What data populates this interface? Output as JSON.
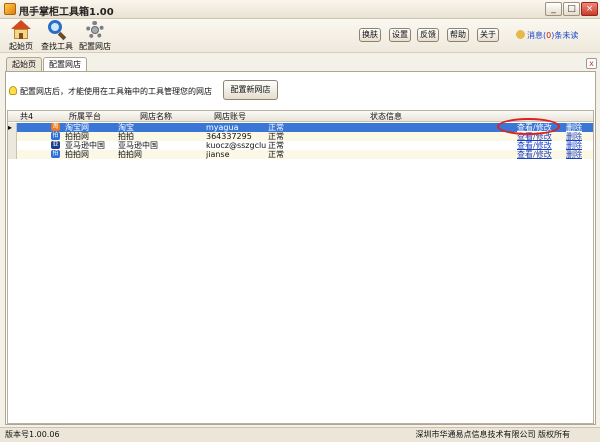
{
  "window": {
    "title": "甩手掌柜工具箱1.00",
    "controls": [
      "_",
      "□",
      "×"
    ]
  },
  "toolbar": {
    "tools": [
      {
        "label": "起始页",
        "icon": "home-icon"
      },
      {
        "label": "查找工具",
        "icon": "search-icon"
      },
      {
        "label": "配置网店",
        "icon": "gear-icon"
      }
    ],
    "buttons": [
      "换肤",
      "设置",
      "反馈",
      "帮助",
      "关于"
    ],
    "message": {
      "label": "消息(",
      "count": "0",
      "close": ")",
      "unread": "条未读"
    }
  },
  "tabs": {
    "items": [
      "起始页",
      "配置网店"
    ],
    "active": 1,
    "close": "x"
  },
  "config": {
    "hint": "配置网店后，才能使用在工具箱中的工具管理您的网店",
    "add_button": "配置新网店"
  },
  "grid": {
    "count_label": "共4",
    "columns": [
      "所属平台",
      "网店名称",
      "网店账号",
      "状态信息"
    ],
    "rows": [
      {
        "platform": "淘宝网",
        "shop": "淘宝",
        "account": "myagua",
        "status": "正常",
        "view": "查看/修改",
        "del": "删除",
        "icon_color": "#f07a1a",
        "icon_glyph": "淘"
      },
      {
        "platform": "拍拍网",
        "shop": "拍拍",
        "account": "364337295",
        "status": "正常",
        "view": "查看/修改",
        "del": "删除",
        "icon_color": "#2d6ed8",
        "icon_glyph": "拍"
      },
      {
        "platform": "亚马逊中国",
        "shop": "亚马逊中国",
        "account": "kuocz@sszgclu...",
        "status": "正常",
        "view": "查看/修改",
        "del": "删除",
        "icon_color": "#1c3f8c",
        "icon_glyph": "亚"
      },
      {
        "platform": "拍拍网",
        "shop": "拍拍网",
        "account": "jianse",
        "status": "正常",
        "view": "查看/修改",
        "del": "删除",
        "icon_color": "#2d6ed8",
        "icon_glyph": "拍"
      }
    ],
    "selected_row": 0
  },
  "status": {
    "version": "版本号1.00.06",
    "copyright": "深圳市华通易点信息技术有限公司 版权所有"
  }
}
